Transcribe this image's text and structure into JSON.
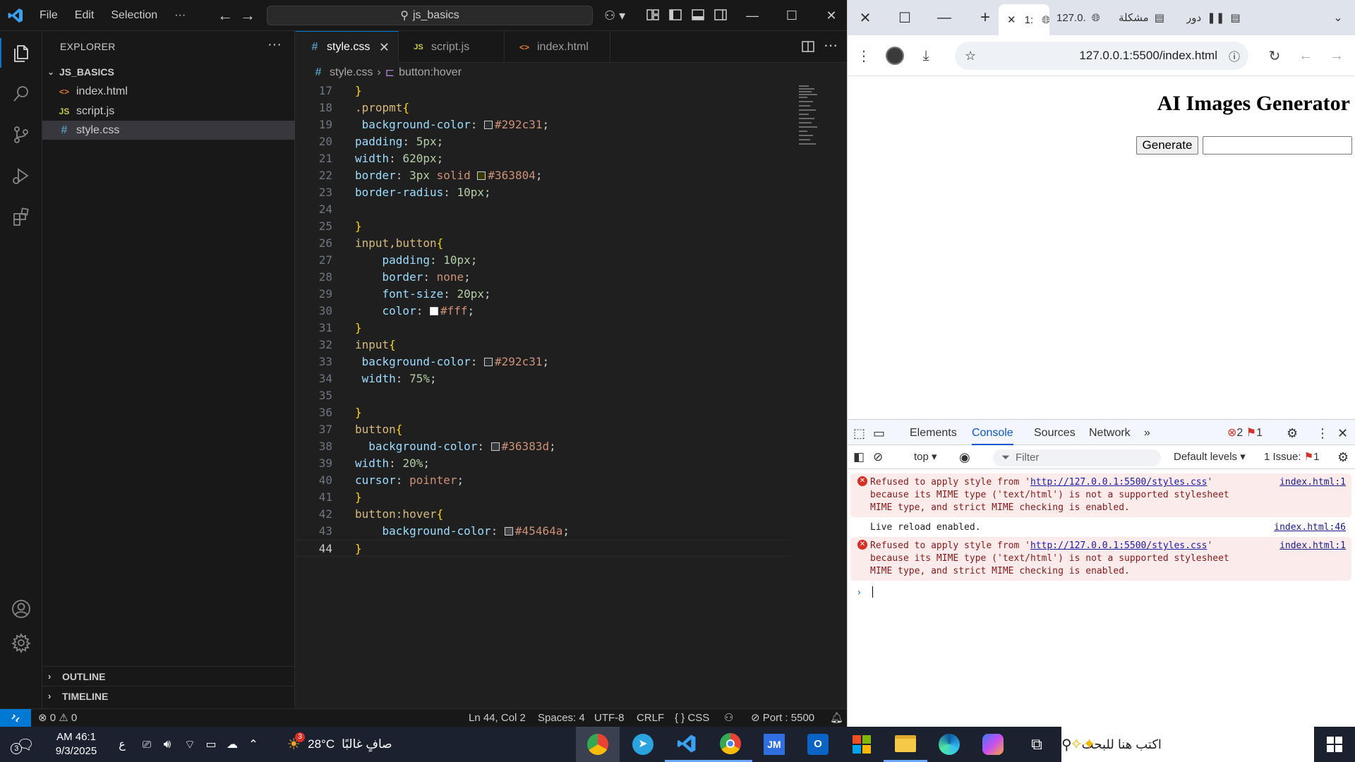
{
  "vscode": {
    "menu": [
      "File",
      "Edit",
      "Selection",
      "···"
    ],
    "command_center": "js_basics",
    "explorer": {
      "header": "EXPLORER",
      "more": "···",
      "root": "JS_BASICS",
      "files": [
        {
          "icon": "<>",
          "name": "index.html"
        },
        {
          "icon": "JS",
          "name": "script.js"
        },
        {
          "icon": "#",
          "name": "style.css"
        }
      ],
      "outline": "OUTLINE",
      "timeline": "TIMELINE"
    },
    "tabs": [
      {
        "icon": "#",
        "label": "style.css",
        "close": "✕"
      },
      {
        "icon": "JS",
        "label": "script.js"
      },
      {
        "icon": "<>",
        "label": "index.html"
      }
    ],
    "breadcrumb": {
      "file": "style.css",
      "sep": "›",
      "symbol": "button:hover"
    },
    "code": {
      "l17": {
        "n": "17",
        "t": "}"
      },
      "l18": {
        "n": "18",
        "sel": ".propmt",
        "b": "{"
      },
      "l19": {
        "n": "19",
        "p": " background-color",
        "c": ": ",
        "v": "#292c31",
        "e": ";",
        "sw": "#292c31"
      },
      "l20": {
        "n": "20",
        "p": "padding",
        "c": ": ",
        "num": "5px",
        "e": ";"
      },
      "l21": {
        "n": "21",
        "p": "width",
        "c": ": ",
        "num": "620px",
        "e": ";"
      },
      "l22": {
        "n": "22",
        "p": "border",
        "c": ": ",
        "num": "3px",
        "v": " solid ",
        "v2": "#363804",
        "e": ";",
        "sw": "#363804"
      },
      "l23": {
        "n": "23",
        "p": "border-radius",
        "c": ": ",
        "num": "10px",
        "e": ";"
      },
      "l24": {
        "n": "24"
      },
      "l25": {
        "n": "25",
        "t": "}"
      },
      "l26": {
        "n": "26",
        "sel": "input,button",
        "b": "{"
      },
      "l27": {
        "n": "27",
        "p": "    padding",
        "c": ": ",
        "num": "10px",
        "e": ";"
      },
      "l28": {
        "n": "28",
        "p": "    border",
        "c": ": ",
        "v": "none",
        "e": ";"
      },
      "l29": {
        "n": "29",
        "p": "    font-size",
        "c": ": ",
        "num": "20px",
        "e": ";"
      },
      "l30": {
        "n": "30",
        "p": "    color",
        "c": ": ",
        "v": "#fff",
        "e": ";",
        "sw": "#ffffff"
      },
      "l31": {
        "n": "31",
        "t": "}"
      },
      "l32": {
        "n": "32",
        "sel": "input",
        "b": "{"
      },
      "l33": {
        "n": "33",
        "p": " background-color",
        "c": ": ",
        "v": "#292c31",
        "e": ";",
        "sw": "#292c31"
      },
      "l34": {
        "n": "34",
        "p": " width",
        "c": ": ",
        "num": "75%",
        "e": ";"
      },
      "l35": {
        "n": "35"
      },
      "l36": {
        "n": "36",
        "t": "}"
      },
      "l37": {
        "n": "37",
        "sel": "button",
        "b": "{"
      },
      "l38": {
        "n": "38",
        "p": "  background-color",
        "c": ": ",
        "v": "#36383d",
        "e": ";",
        "sw": "#36383d"
      },
      "l39": {
        "n": "39",
        "p": "width",
        "c": ": ",
        "num": "20%",
        "e": ";"
      },
      "l40": {
        "n": "40",
        "p": "cursor",
        "c": ": ",
        "v": "pointer",
        "e": ";"
      },
      "l41": {
        "n": "41",
        "t": "}"
      },
      "l42": {
        "n": "42",
        "sel": "button:hover",
        "b": "{"
      },
      "l43": {
        "n": "43",
        "p": "    background-color",
        "c": ": ",
        "v": "#45464a",
        "e": ";",
        "sw": "#45464a"
      },
      "l44": {
        "n": "44",
        "t": "}"
      }
    },
    "status": {
      "errors": "0",
      "warnings": "0",
      "position": "Ln 44, Col 2",
      "spaces": "Spaces: 4",
      "encoding": "UTF-8",
      "eol": "CRLF",
      "language": "CSS",
      "port": "Port : 5500"
    }
  },
  "browser": {
    "tabs": [
      {
        "label": "1:"
      },
      {
        "label": "127.0."
      },
      {
        "label": "مشكلة"
      },
      {
        "label": "دور"
      }
    ],
    "url": "127.0.0.1:5500/index.html",
    "page": {
      "heading": "AI Images Generator",
      "button": "Generate"
    },
    "devtools": {
      "tabs": [
        "Elements",
        "Console",
        "Sources",
        "Network",
        "»"
      ],
      "error_count": "2",
      "issue_count": "1",
      "context": "top ▾",
      "filter_placeholder": "Filter",
      "levels": "Default levels ▾",
      "issues": "1 Issue:",
      "issues_count": "1",
      "messages": [
        {
          "type": "error",
          "pre": "Refused to apply style from '",
          "link": "http://127.0.0.1:5500/styles.css",
          "post": "' because its MIME type ('text/html') is not a supported stylesheet MIME type, and strict MIME checking is enabled.",
          "source": "index.html:1"
        },
        {
          "type": "log",
          "text": "Live reload enabled.",
          "source": "index.html:46"
        },
        {
          "type": "error",
          "pre": "Refused to apply style from '",
          "link": "http://127.0.0.1:5500/styles.css",
          "post": "' because its MIME type ('text/html') is not a supported stylesheet MIME type, and strict MIME checking is enabled.",
          "source": "index.html:1"
        }
      ],
      "prompt": "›"
    }
  },
  "taskbar": {
    "notif_count": "3",
    "time": "AM 46:1",
    "date": "9/3/2025",
    "lang": "ع",
    "weather_temp": "28°C",
    "weather_text": "صافٍ غالبًا",
    "weather_badge": "3",
    "search_placeholder": "اكتب هنا للبحث",
    "apps": [
      "chrome-profile",
      "telegram",
      "vscode",
      "chrome",
      "jetbrains",
      "outlook",
      "store",
      "file-explorer",
      "edge",
      "copilot",
      "task-view"
    ]
  }
}
